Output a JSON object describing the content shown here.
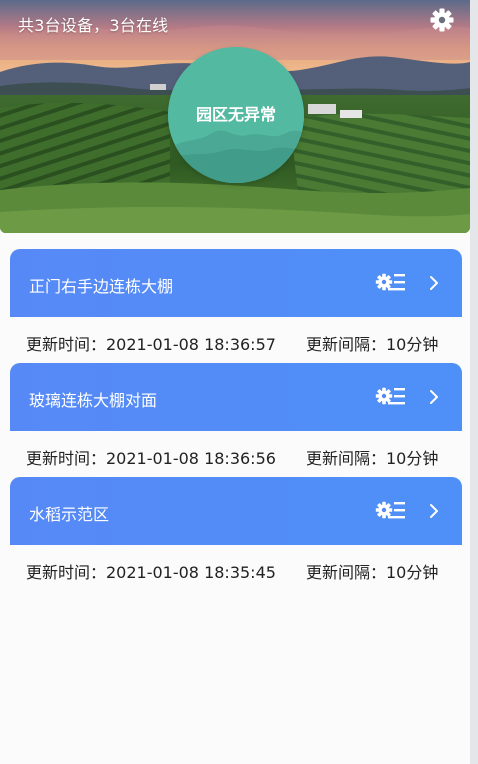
{
  "header": {
    "device_summary": "共3台设备，3台在线",
    "settings_icon": "gear-icon"
  },
  "status": {
    "text": "园区无异常",
    "color": "#52b8a0"
  },
  "theme": {
    "card_gradient_start": "#5789f6",
    "card_gradient_end": "#4e90f8"
  },
  "devices": [
    {
      "name": "正门右手边连栋大棚",
      "update_time": "更新时间：2021-01-08 18:36:57",
      "update_interval": "更新间隔：10分钟"
    },
    {
      "name": "玻璃连栋大棚对面",
      "update_time": "更新时间：2021-01-08 18:36:56",
      "update_interval": "更新间隔：10分钟"
    },
    {
      "name": "水稻示范区",
      "update_time": "更新时间：2021-01-08 18:35:45",
      "update_interval": "更新间隔：10分钟"
    }
  ]
}
